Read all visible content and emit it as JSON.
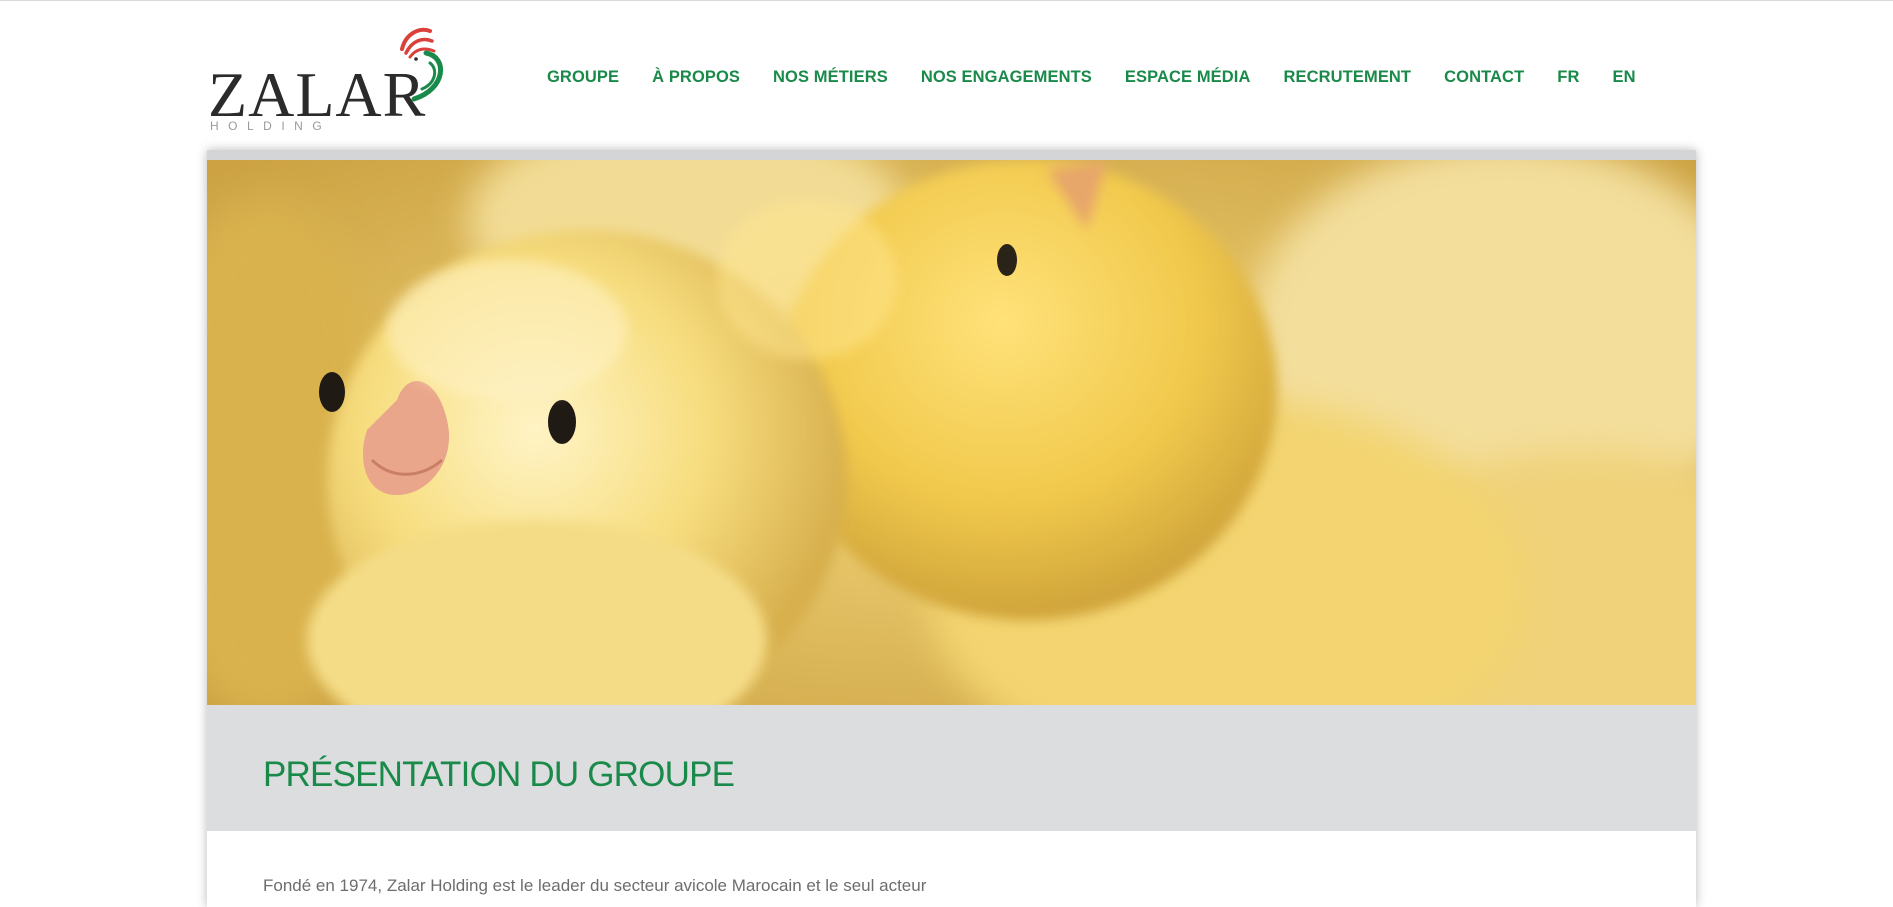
{
  "brand": {
    "name": "ZALAR",
    "subtitle": "HOLDING",
    "accent_green": "#1a8a4a",
    "accent_red": "#d9413a"
  },
  "nav": {
    "items": [
      {
        "label": "GROUPE",
        "icon": ""
      },
      {
        "label": "À PROPOS",
        "icon": ""
      },
      {
        "label": "NOS MÉTIERS",
        "icon": ""
      },
      {
        "label": "NOS ENGAGEMENTS",
        "icon": ""
      },
      {
        "label": "ESPACE MÉDIA",
        "icon": ""
      },
      {
        "label": "RECRUTEMENT",
        "icon": ""
      },
      {
        "label": "CONTACT",
        "icon": ""
      },
      {
        "label": "FR",
        "icon": ""
      },
      {
        "label": "EN",
        "icon": ""
      }
    ]
  },
  "hero": {
    "image": "yellow-chicks-photo"
  },
  "main": {
    "title": "PRÉSENTATION DU GROUPE",
    "intro": "Fondé en 1974, Zalar Holding est le leader du secteur avicole Marocain et le seul acteur"
  }
}
